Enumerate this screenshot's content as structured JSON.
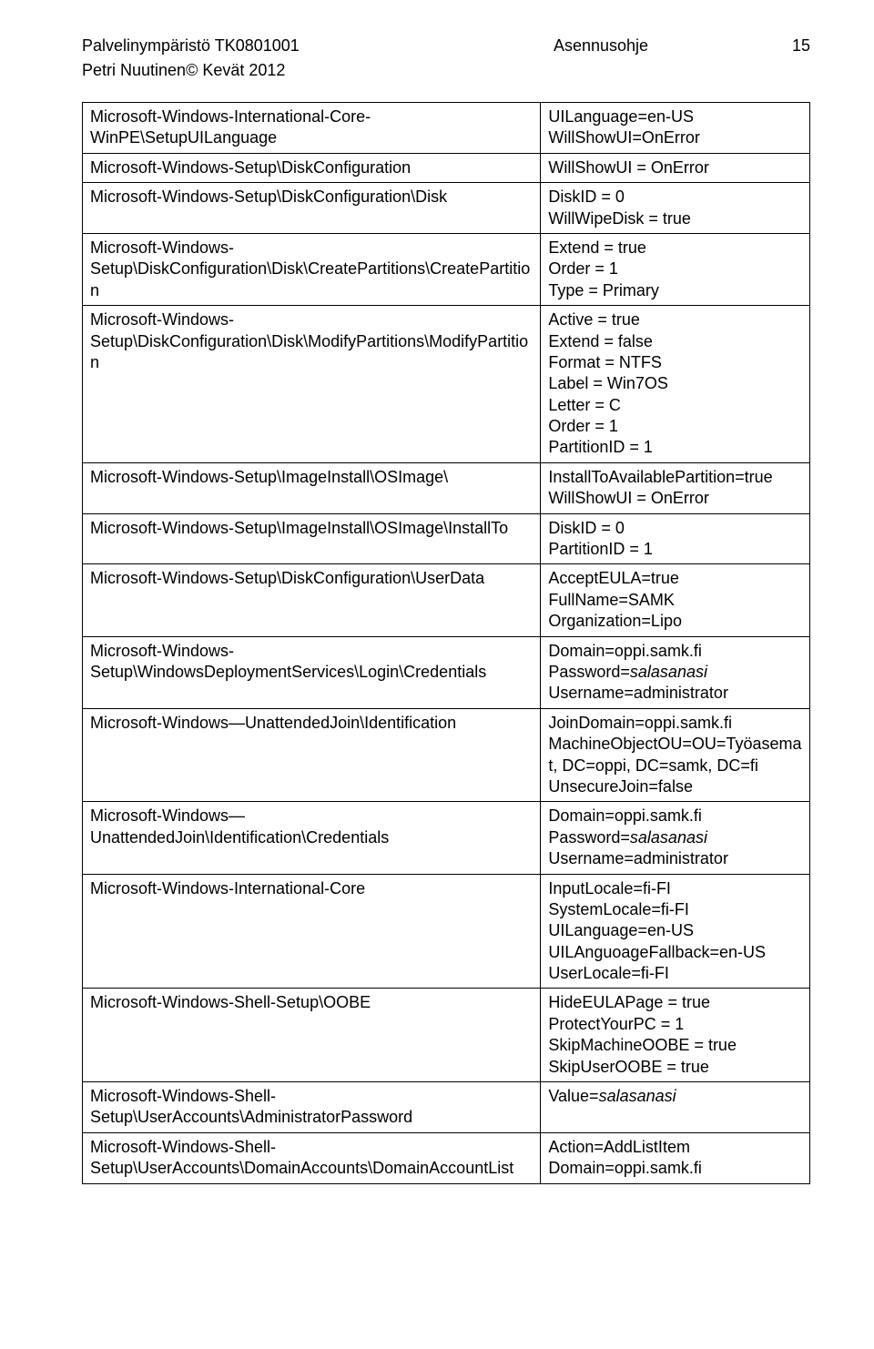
{
  "header": {
    "left": "Palvelinympäristö TK0801001",
    "mid": "Asennusohje",
    "right": "15",
    "sub": "Petri Nuutinen© Kevät 2012"
  },
  "rows": [
    {
      "left": "Microsoft-Windows-International-Core-WinPE\\SetupUILanguage",
      "right": "UILanguage=en-US\nWillShowUI=OnError"
    },
    {
      "left": "Microsoft-Windows-Setup\\DiskConfiguration",
      "right": "WillShowUI = OnError"
    },
    {
      "left": "Microsoft-Windows-Setup\\DiskConfiguration\\Disk",
      "right": "DiskID = 0\nWillWipeDisk = true"
    },
    {
      "left": "Microsoft-Windows-Setup\\DiskConfiguration\\Disk\\CreatePartitions\\CreatePartition",
      "right": "Extend = true\nOrder = 1\nType = Primary"
    },
    {
      "left": "Microsoft-Windows-Setup\\DiskConfiguration\\Disk\\ModifyPartitions\\ModifyPartition",
      "right": "Active = true\nExtend = false\nFormat = NTFS\nLabel = Win7OS\nLetter = C\nOrder = 1\nPartitionID = 1"
    },
    {
      "left": "Microsoft-Windows-Setup\\ImageInstall\\OSImage\\",
      "right": "InstallToAvailablePartition=true\nWillShowUI = OnError"
    },
    {
      "left": "Microsoft-Windows-Setup\\ImageInstall\\OSImage\\InstallTo",
      "right": "DiskID = 0\nPartitionID = 1"
    },
    {
      "left": "Microsoft-Windows-Setup\\DiskConfiguration\\UserData",
      "right": "AcceptEULA=true\nFullName=SAMK\nOrganization=Lipo"
    },
    {
      "left": "Microsoft-Windows-Setup\\WindowsDeploymentServices\\Login\\Credentials",
      "right_html": "Domain=oppi.samk.fi<br>Password=<span class=\"ital\">salasanasi</span><br>Username=administrator"
    },
    {
      "left": "Microsoft-Windows—UnattendedJoin\\Identification",
      "right": "JoinDomain=oppi.samk.fi\nMachineObjectOU=OU=Työasemat, DC=oppi, DC=samk, DC=fi\nUnsecureJoin=false"
    },
    {
      "left": "Microsoft-Windows—UnattendedJoin\\Identification\\Credentials",
      "right_html": "Domain=oppi.samk.fi<br>Password=<span class=\"ital\">salasanasi</span><br>Username=administrator"
    },
    {
      "left": "Microsoft-Windows-International-Core",
      "right": "InputLocale=fi-FI\nSystemLocale=fi-FI\nUILanguage=en-US\nUILAnguoageFallback=en-US\nUserLocale=fi-FI"
    },
    {
      "left": "Microsoft-Windows-Shell-Setup\\OOBE",
      "right": "HideEULAPage = true\nProtectYourPC = 1\nSkipMachineOOBE = true\nSkipUserOOBE = true"
    },
    {
      "left": "Microsoft-Windows-Shell-Setup\\UserAccounts\\AdministratorPassword",
      "right_html": "Value=<span class=\"ital\">salasanasi</span>"
    },
    {
      "left": "Microsoft-Windows-Shell-Setup\\UserAccounts\\DomainAccounts\\DomainAccountList",
      "right": "Action=AddListItem\nDomain=oppi.samk.fi"
    }
  ]
}
